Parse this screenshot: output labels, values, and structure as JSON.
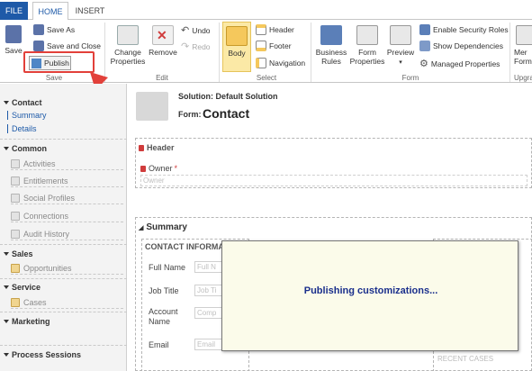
{
  "tabs": {
    "file": "FILE",
    "home": "HOME",
    "insert": "INSERT"
  },
  "ribbon": {
    "save": {
      "save": "Save",
      "save_as": "Save As",
      "save_and_close": "Save and Close",
      "publish": "Publish",
      "group": "Save"
    },
    "edit": {
      "change_properties_line1": "Change",
      "change_properties_line2": "Properties",
      "remove": "Remove",
      "undo": "Undo",
      "redo": "Redo",
      "group": "Edit"
    },
    "select": {
      "body": "Body",
      "header": "Header",
      "footer": "Footer",
      "navigation": "Navigation",
      "group": "Select"
    },
    "form": {
      "business_rules_line1": "Business",
      "business_rules_line2": "Rules",
      "form_properties_line1": "Form",
      "form_properties_line2": "Properties",
      "preview": "Preview",
      "enable_security_roles": "Enable Security Roles",
      "show_dependencies": "Show Dependencies",
      "managed_properties": "Managed Properties",
      "group": "Form"
    },
    "upgrade": {
      "merge_forms_line1": "Mer",
      "merge_forms_line2": "Form",
      "group": "Upgra"
    }
  },
  "nav": {
    "contact": {
      "heading": "Contact",
      "items": [
        "Summary",
        "Details"
      ]
    },
    "common": {
      "heading": "Common",
      "items": [
        "Activities",
        "Entitlements",
        "Social Profiles",
        "Connections",
        "Audit History"
      ]
    },
    "sales": {
      "heading": "Sales",
      "items": [
        "Opportunities"
      ]
    },
    "service": {
      "heading": "Service",
      "items": [
        "Cases"
      ]
    },
    "marketing": {
      "heading": "Marketing"
    },
    "process_sessions": {
      "heading": "Process Sessions"
    }
  },
  "form": {
    "solution_label": "Solution: Default Solution",
    "form_label": "Form:",
    "form_name": "Contact",
    "header_section": "Header",
    "owner_label": "Owner",
    "owner_required": "*",
    "owner_placeholder": "Owner",
    "summary_section": "Summary",
    "contact_information": "CONTACT INFORMA",
    "fields": [
      {
        "label": "Full Name",
        "value": "Full N"
      },
      {
        "label": "Job Title",
        "value": "Job Ti"
      },
      {
        "label_line1": "Account",
        "label_line2": "Name",
        "value": "Comp"
      },
      {
        "label": "Email",
        "value": "Email"
      }
    ],
    "recent_cases": "RECENT CASES"
  },
  "modal": {
    "message": "Publishing customizations..."
  },
  "colors": {
    "accent": "#1e5aa8",
    "highlight": "#e2403a",
    "modal_bg": "#fbfbea",
    "modal_text": "#1a2f8c"
  }
}
